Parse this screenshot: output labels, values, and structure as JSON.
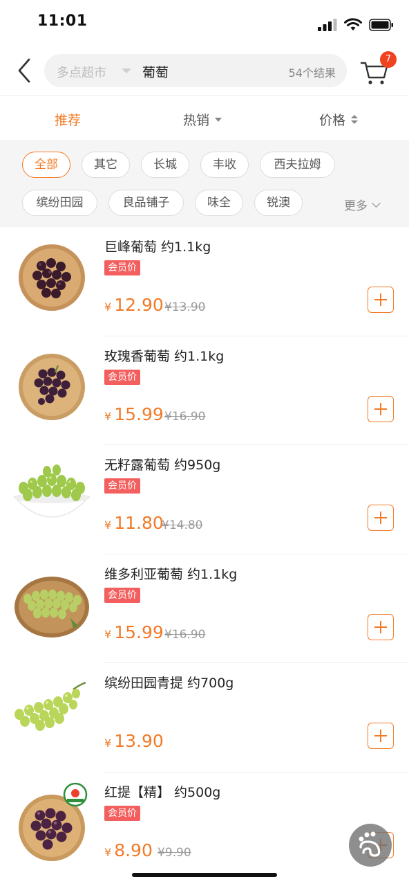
{
  "status_bar": {
    "time": "11:01"
  },
  "header": {
    "store": "多点超市",
    "query": "葡萄",
    "result_count": "54个结果",
    "cart_badge": "7"
  },
  "sort_tabs": [
    {
      "label": "推荐",
      "active": true
    },
    {
      "label": "热销"
    },
    {
      "label": "价格"
    }
  ],
  "brand_filters": [
    "全部",
    "其它",
    "长城",
    "丰收",
    "西夫拉姆",
    "缤纷田园",
    "良品铺子",
    "味全",
    "锐澳"
  ],
  "more_label": "更多",
  "products": [
    {
      "name": "巨峰葡萄 约1.1kg",
      "tag": "会员价",
      "yen": "¥",
      "price": "12.90",
      "original": "¥13.90",
      "image": "dark-purple-grapes-plate"
    },
    {
      "name": "玫瑰香葡萄 约1.1kg",
      "tag": "会员价",
      "yen": "¥",
      "price": "15.99",
      "original": "¥16.90",
      "image": "purple-grapes-plate"
    },
    {
      "name": "无籽露葡萄 约950g",
      "tag": "会员价",
      "yen": "¥",
      "price": "11.80",
      "original": "¥14.80",
      "image": "green-grapes-bowl"
    },
    {
      "name": "维多利亚葡萄 约1.1kg",
      "tag": "会员价",
      "yen": "¥",
      "price": "15.99",
      "original": "¥16.90",
      "image": "green-grapes-basket"
    },
    {
      "name": "缤纷田园青提 约700g",
      "tag": "",
      "yen": "¥",
      "price": "13.90",
      "original": "",
      "image": "green-grapes-bunch"
    },
    {
      "name": "红提【精】 约500g",
      "tag": "会员价",
      "yen": "¥",
      "price": "8.90",
      "original": "¥9.90",
      "image": "red-grapes-plate"
    }
  ],
  "colors": {
    "accent": "#f27a27",
    "member_tag": "#f35e5e",
    "badge": "#f0421f"
  }
}
